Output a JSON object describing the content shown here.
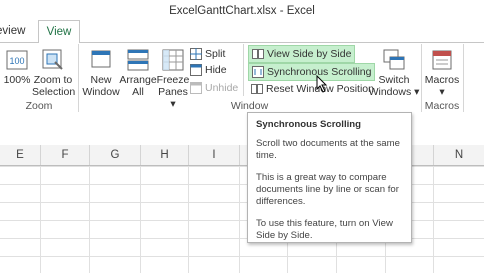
{
  "window": {
    "title": "ExcelGanttChart.xlsx - Excel"
  },
  "tabs": [
    {
      "label": "eview"
    },
    {
      "label": "View"
    }
  ],
  "ribbon": {
    "zoom_group": {
      "label": "Zoom",
      "btn_100": "100%",
      "btn_zoom_selection": [
        "Zoom to",
        "Selection"
      ]
    },
    "window_group": {
      "label": "Window",
      "new_window": [
        "New",
        "Window"
      ],
      "arrange_all": [
        "Arrange",
        "All"
      ],
      "freeze_panes": [
        "Freeze",
        "Panes ▾"
      ],
      "split": "Split",
      "hide": "Hide",
      "unhide": "Unhide",
      "view_side_by_side": "View Side by Side",
      "synchronous_scrolling": "Synchronous Scrolling",
      "reset_window_position": "Reset Window Position",
      "switch_windows": [
        "Switch",
        "Windows ▾"
      ]
    },
    "macros_group": {
      "label": "Macros",
      "macros": "Macros ▾"
    }
  },
  "columns": [
    "E",
    "F",
    "G",
    "H",
    "I",
    "N"
  ],
  "tooltip": {
    "title": "Synchronous Scrolling",
    "p1": "Scroll two documents at the same time.",
    "p2": "This is a great way to compare documents line by line or scan for differences.",
    "p3": "To use this feature, turn on View Side by Side."
  },
  "colors": {
    "accent": "#217346",
    "highlight": "#c6efce"
  }
}
